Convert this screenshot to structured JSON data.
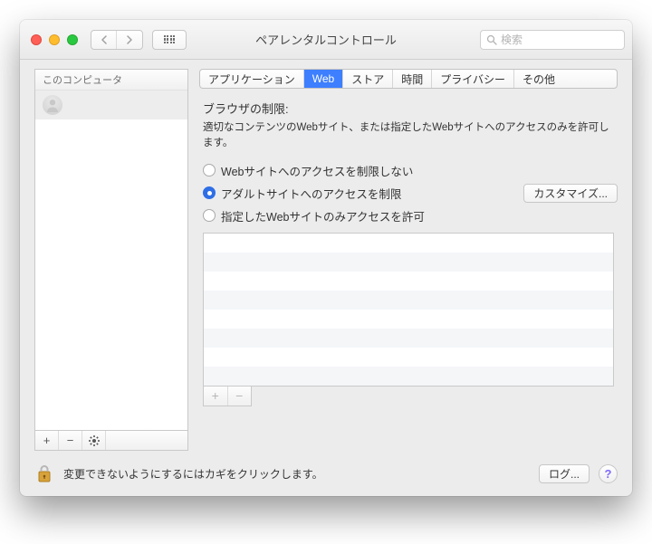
{
  "window": {
    "title": "ペアレンタルコントロール"
  },
  "search": {
    "placeholder": "検索"
  },
  "sidebar": {
    "header": "このコンピュータ",
    "items": [
      {
        "label": ""
      }
    ],
    "buttons": {
      "add": "+",
      "remove": "−",
      "gear": "✽"
    }
  },
  "tabs": [
    {
      "id": "apps",
      "label": "アプリケーション",
      "active": false
    },
    {
      "id": "web",
      "label": "Web",
      "active": true
    },
    {
      "id": "store",
      "label": "ストア",
      "active": false
    },
    {
      "id": "time",
      "label": "時間",
      "active": false
    },
    {
      "id": "privacy",
      "label": "プライバシー",
      "active": false
    },
    {
      "id": "other",
      "label": "その他",
      "active": false
    }
  ],
  "web": {
    "section_title": "ブラウザの制限:",
    "section_desc": "適切なコンテンツのWebサイト、または指定したWebサイトへのアクセスのみを許可します。",
    "options": [
      {
        "id": "no-restrict",
        "label": "Webサイトへのアクセスを制限しない",
        "checked": false
      },
      {
        "id": "limit-adult",
        "label": "アダルトサイトへのアクセスを制限",
        "checked": true
      },
      {
        "id": "allowlist",
        "label": "指定したWebサイトのみアクセスを許可",
        "checked": false
      }
    ],
    "customize_button": "カスタマイズ...",
    "list_buttons": {
      "add": "+",
      "remove": "−"
    }
  },
  "footer": {
    "lock_text": "変更できないようにするにはカギをクリックします。",
    "log_button": "ログ...",
    "help": "?"
  }
}
